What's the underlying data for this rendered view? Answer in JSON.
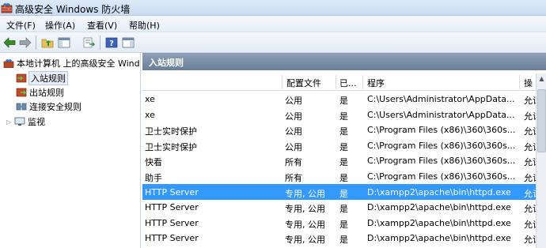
{
  "window": {
    "title": "高级安全 Windows 防火墙"
  },
  "menu": [
    "文件(F)",
    "操作(A)",
    "查看(V)",
    "帮助(H)"
  ],
  "toolbar": [
    "back-arrow-icon",
    "forward-arrow-icon",
    "up-folder-icon",
    "show-hide-tree-icon",
    "export-list-icon",
    "help-icon",
    "show-hide-action-pane-icon"
  ],
  "tree": {
    "root": "本地计算机 上的高级安全 Wind",
    "items": [
      "入站规则",
      "出站规则",
      "连接安全规则",
      "监视"
    ]
  },
  "panel": {
    "title": "入站规则"
  },
  "columns": [
    "配置文件",
    "已...",
    "程序",
    "操"
  ],
  "rows": [
    {
      "name": "xe",
      "profile": "公用",
      "enabled": "是",
      "program": "C:\\Users\\Administrator\\AppData...",
      "action": "允许"
    },
    {
      "name": "xe",
      "profile": "公用",
      "enabled": "是",
      "program": "C:\\Users\\Administrator\\AppData...",
      "action": "允许"
    },
    {
      "name": "卫士实时保护",
      "profile": "公用",
      "enabled": "是",
      "program": "C:\\Program Files (x86)\\360\\360s...",
      "action": "允许"
    },
    {
      "name": "卫士实时保护",
      "profile": "公用",
      "enabled": "是",
      "program": "C:\\Program Files (x86)\\360\\360s...",
      "action": "允许"
    },
    {
      "name": "快看",
      "profile": "所有",
      "enabled": "是",
      "program": "C:\\Program Files (x86)\\360\\360s...",
      "action": "允许"
    },
    {
      "name": "助手",
      "profile": "所有",
      "enabled": "是",
      "program": "C:\\Program Files (x86)\\360\\360s...",
      "action": "允许"
    },
    {
      "name": "HTTP Server",
      "profile": "专用, 公用",
      "enabled": "是",
      "program": "D:\\xampp2\\apache\\bin\\httpd.exe",
      "action": "允许"
    },
    {
      "name": "HTTP Server",
      "profile": "专用, 公用",
      "enabled": "是",
      "program": "D:\\xampp2\\apache\\bin\\httpd.exe",
      "action": "允许"
    },
    {
      "name": "HTTP Server",
      "profile": "专用, 公用",
      "enabled": "是",
      "program": "D:\\xampp2\\apache\\bin\\httpd.exe",
      "action": "允许"
    },
    {
      "name": "HTTP Server",
      "profile": "专用, 公用",
      "enabled": "是",
      "program": "D:\\xampp2\\apache\\bin\\httpd.exe",
      "action": "允许"
    }
  ],
  "selected_row": 6,
  "colors": {
    "selection": "#3399ff",
    "panel_header": "#7d90a9"
  }
}
